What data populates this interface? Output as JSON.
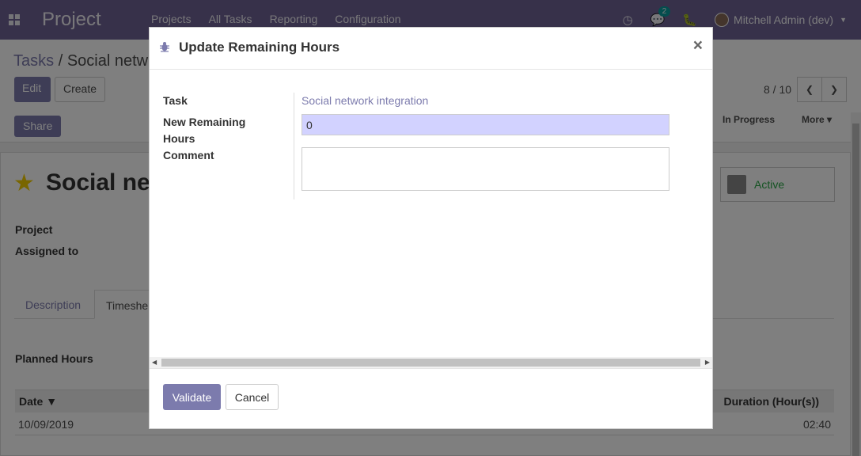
{
  "navbar": {
    "brand": "Project",
    "menu": [
      "Projects",
      "All Tasks",
      "Reporting",
      "Configuration"
    ],
    "chat_count": "2",
    "user": "Mitchell Admin (dev)"
  },
  "control_panel": {
    "breadcrumb_root": "Tasks",
    "breadcrumb_sep": "/",
    "breadcrumb_current": "Social netw",
    "edit_label": "Edit",
    "create_label": "Create",
    "pager": "8 / 10",
    "share_label": "Share",
    "stage": "In Progress",
    "more_label": "More"
  },
  "record": {
    "title": "Social net",
    "active_label": "Active",
    "fields": [
      "Project",
      "Assigned to"
    ],
    "tabs": [
      "Description",
      "Timeshe"
    ],
    "planned_hours_label": "Planned Hours",
    "table": {
      "col_date": "Date",
      "col_duration": "Duration (Hour(s))",
      "row_date": "10/09/2019",
      "row_duration": "02:40"
    }
  },
  "dialog": {
    "title": "Update Remaining Hours",
    "close": "×",
    "labels": {
      "task": "Task",
      "new_remaining_1": "New Remaining",
      "new_remaining_2": "Hours",
      "comment": "Comment"
    },
    "task_value": "Social network integration",
    "hours_value": "0",
    "comment_value": "",
    "validate_label": "Validate",
    "cancel_label": "Cancel"
  },
  "colors": {
    "navbar": "#6f6394",
    "primary": "#7c7bad",
    "input_highlight": "#d2d2ff",
    "active_status": "#28a745"
  }
}
